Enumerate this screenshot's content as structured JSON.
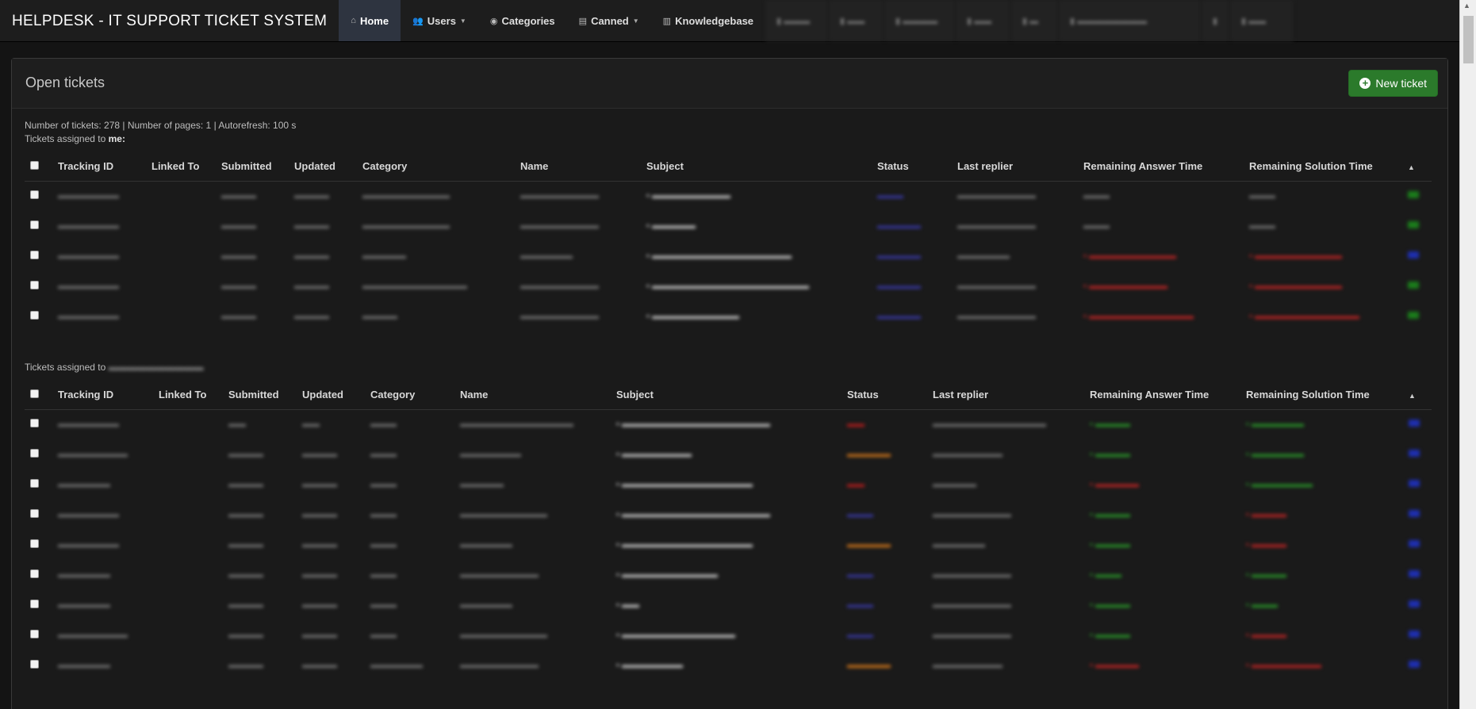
{
  "nav": {
    "brand": "HELPDESK - IT SUPPORT TICKET SYSTEM",
    "items": [
      {
        "label": "Home",
        "icon": "home-icon",
        "active": true
      },
      {
        "label": "Users",
        "icon": "users-icon",
        "dropdown": true
      },
      {
        "label": "Categories",
        "icon": "tag-icon"
      },
      {
        "label": "Canned",
        "icon": "document-icon",
        "dropdown": true
      },
      {
        "label": "Knowledgebase",
        "icon": "book-icon"
      }
    ]
  },
  "panel": {
    "title": "Open tickets",
    "new_ticket": "New ticket"
  },
  "summary": "Number of tickets: 278 | Number of pages: 1 | Autorefresh: 100 s",
  "section1": {
    "label_prefix": "Tickets assigned to ",
    "label_who": "me:"
  },
  "section2": {
    "label_prefix": "Tickets assigned to "
  },
  "columns1": [
    "Tracking ID",
    "Linked To",
    "Submitted",
    "Updated",
    "Category",
    "Name",
    "Subject",
    "Status",
    "Last replier",
    "Remaining Answer Time",
    "Remaining Solution Time"
  ],
  "columns2": [
    "Tracking ID",
    "Linked To",
    "Submitted",
    "Updated",
    "Category",
    "Name",
    "Subject",
    "Status",
    "Last replier",
    "Remaining Answer Time",
    "Remaining Solution Time"
  ],
  "sort_indicator": "▲",
  "colors": {
    "accent_green": "#2b7a2b",
    "status_blue": "#3a3aa8",
    "status_red": "#c21d1d",
    "status_orange": "#d97a1b"
  }
}
